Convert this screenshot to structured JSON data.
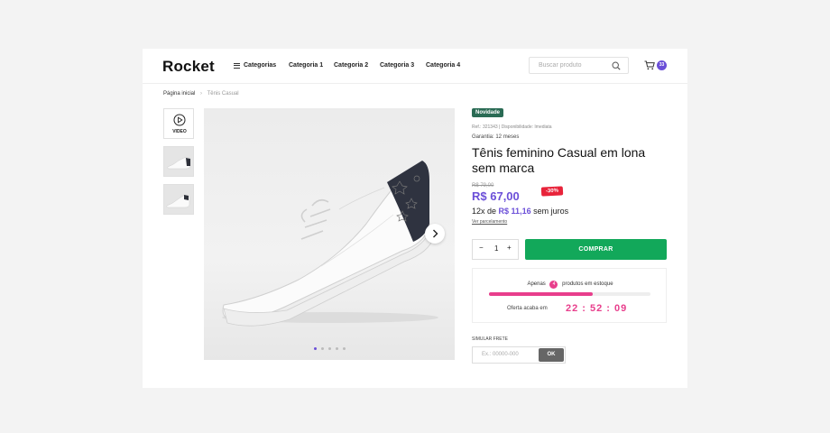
{
  "header": {
    "logo": "Rocket",
    "nav": [
      "Categorias",
      "Categoria 1",
      "Categoria 2",
      "Categoria 3",
      "Categoria 4"
    ],
    "search_placeholder": "Buscar produto",
    "cart_count": "33"
  },
  "breadcrumb": {
    "home": "Página inicial",
    "current": "Tênis Casual"
  },
  "gallery": {
    "video_label": "VIDEO",
    "slide_count": 5,
    "active_slide": 1
  },
  "product": {
    "tag": "Novidade",
    "ref": "Ref.: 321343  |  Disponibilidade: Imediata",
    "warranty": "Garantia: 12 meses",
    "title": "Tênis feminino Casual em lona sem marca",
    "old_price": "R$ 79,00",
    "price": "R$ 67,00",
    "discount": "-30%",
    "installments_prefix": "12x de",
    "installments_value": "R$ 11,16",
    "installments_suffix": "sem juros",
    "installments_link": "Ver parcelamento",
    "quantity": "1",
    "buy_label": "COMPRAR"
  },
  "stock": {
    "prefix": "Apenas",
    "count": "4",
    "suffix": "produtos em estoque",
    "level_fraction": 0.64,
    "offer_label": "Oferta acaba em",
    "timer": "22 : 52 : 09"
  },
  "shipping": {
    "label": "SIMULAR FRETE",
    "placeholder": "Ex.: 00000-000",
    "ok_label": "OK"
  },
  "colors": {
    "accent": "#6b4fd8",
    "buy": "#12a85a",
    "discount": "#e8233a",
    "stock": "#e83e8c",
    "tag": "#2a6b54"
  }
}
